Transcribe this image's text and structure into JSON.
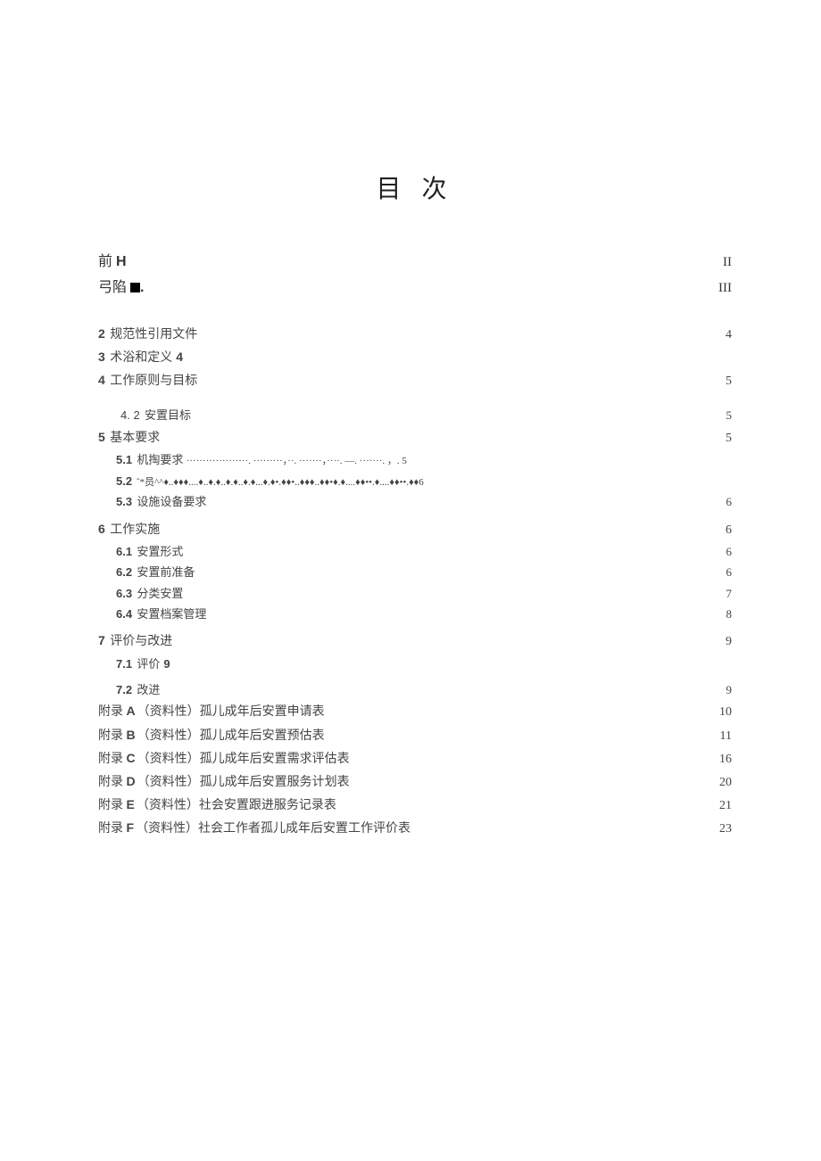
{
  "title": "目 次",
  "front": [
    {
      "label_a": "前",
      "label_b": "H",
      "page": "II"
    },
    {
      "label_a": "弓陷",
      "label_b": "■.",
      "page": "III",
      "square": true
    }
  ],
  "entries": [
    {
      "type": "dotted",
      "level": 1,
      "num": "2",
      "num_bold": true,
      "label": "规范性引用文件",
      "page": "4"
    },
    {
      "type": "inline",
      "level": 1,
      "num": "3",
      "num_bold": true,
      "label": "术浴和定义",
      "page": "4"
    },
    {
      "type": "dotted",
      "level": 1,
      "num": "4",
      "num_bold": true,
      "label": "工作原则与目标",
      "page": "5"
    },
    {
      "type": "spacer",
      "size": "md"
    },
    {
      "type": "dotted",
      "level": 2,
      "indent_more": true,
      "num": "4. 2",
      "num_bold": false,
      "label": "安置目标",
      "page": "5"
    },
    {
      "type": "dotted",
      "level": 1,
      "num": "5",
      "num_bold": true,
      "label": "基本要求",
      "page": "5"
    },
    {
      "type": "raw",
      "level": 2,
      "text_parts": [
        "5.1",
        " 机掏要求 ",
        "···················. ·········，··. ·······，····. —. ·······. ，. 5"
      ]
    },
    {
      "type": "raw",
      "level": 2,
      "text_parts": [
        "5.2",
        " ˆ*员^^♦..♦♦♦....♦..♦.♦..♦.♦..♦.♦...♦.♦•.♦♦•..♦♦♦..♦♦•♦.♦....♦♦••.♦....♦♦••.♦♦6"
      ]
    },
    {
      "type": "dotted",
      "level": 2,
      "num": "5.3",
      "num_bold": true,
      "label": "设施设备要求",
      "gap_after_label": true,
      "page": "6"
    },
    {
      "type": "spacer",
      "size": "sm"
    },
    {
      "type": "dotted",
      "level": 1,
      "num": "6",
      "num_bold": true,
      "label": "工作实施",
      "page": "6"
    },
    {
      "type": "dotted",
      "level": 2,
      "num": "6.1",
      "num_bold": true,
      "label": "安置形式",
      "page": "6"
    },
    {
      "type": "dotted",
      "level": 2,
      "num": "6.2",
      "num_bold": true,
      "label": "安置前准备",
      "page": "6"
    },
    {
      "type": "dotted",
      "level": 2,
      "num": "6.3",
      "num_bold": true,
      "label": "分类安置",
      "page": "7"
    },
    {
      "type": "dotted",
      "level": 2,
      "num": "6.4",
      "num_bold": true,
      "label": "安置档案管理",
      "page": "8"
    },
    {
      "type": "spacer",
      "size": "sm"
    },
    {
      "type": "dotted",
      "level": 1,
      "num": "7",
      "num_bold": true,
      "label": "评价与改进",
      "page": "9"
    },
    {
      "type": "inline",
      "level": 2,
      "num": "7.1",
      "num_bold": true,
      "label": "评价",
      "page": "9"
    },
    {
      "type": "spacer",
      "size": "sm"
    },
    {
      "type": "dotted",
      "level": 2,
      "num": "7.2",
      "num_bold": true,
      "label": "改进",
      "page": "9"
    },
    {
      "type": "dotted",
      "level": 1,
      "num": "",
      "label": "附录 A（资料性）孤儿成年后安置申请表",
      "bold_letter": "A",
      "page": "10"
    },
    {
      "type": "dotted",
      "level": 1,
      "num": "",
      "label": "附录 B（资料性）孤儿成年后安置预估表",
      "bold_letter": "B",
      "page": "11"
    },
    {
      "type": "dotted",
      "level": 1,
      "num": "",
      "label": "附录 C（资料性）孤儿成年后安置需求评估表",
      "bold_letter": "C",
      "page": "16"
    },
    {
      "type": "dotted",
      "level": 1,
      "num": "",
      "label": "附录 D（资料性）孤儿成年后安置服务计划表",
      "bold_letter": "D",
      "page": "20"
    },
    {
      "type": "dotted",
      "level": 1,
      "num": "",
      "label": "附录 E（资料性）社会安置跟进服务记录表",
      "bold_letter": "E",
      "page": "21"
    },
    {
      "type": "dotted",
      "level": 1,
      "num": "",
      "label": "附录 F（资料性）社会工作者孤儿成年后安置工作评价表",
      "bold_letter": "F",
      "page": "23"
    }
  ]
}
